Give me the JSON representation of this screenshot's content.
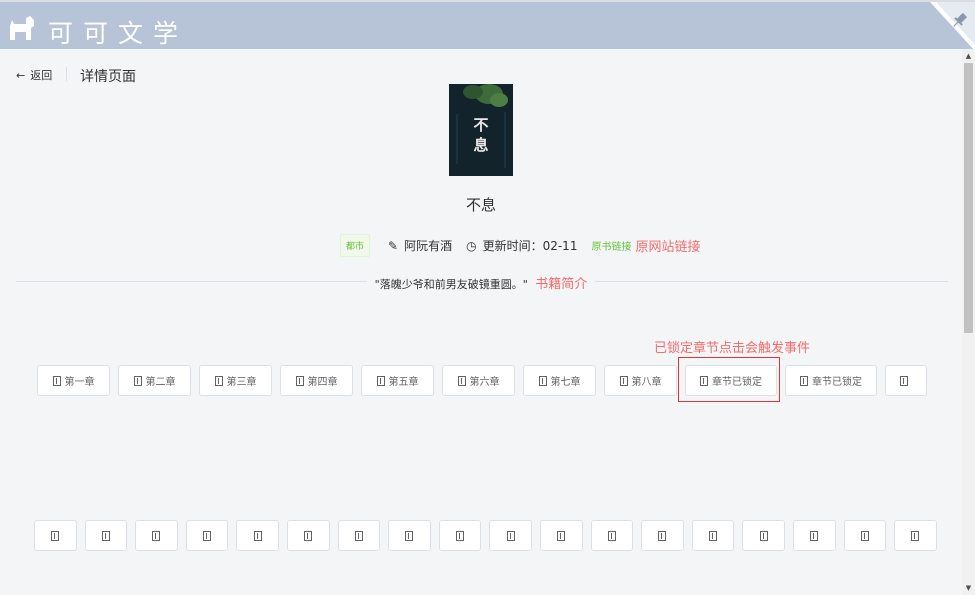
{
  "header": {
    "site_title": "可可文学",
    "logo_icon": "dog-icon",
    "corner_icon": "pin-icon",
    "background": "#b7c3d6"
  },
  "nav": {
    "back_label": "返回",
    "page_title": "详情页面"
  },
  "book": {
    "cover_chars": [
      "不",
      "息"
    ],
    "title": "不息",
    "category_tag": "都市",
    "author": "阿阮有酒",
    "update_label": "更新时间：02-11",
    "original_link_label": "原书链接",
    "original_link_annotation": "原网站链接",
    "intro": "\"落魄少爷和前男友破镜重圆。\"",
    "intro_annotation": "书籍简介"
  },
  "locked_annotation": "已锁定章节点击会触发事件",
  "chapters_row1": [
    {
      "label": "第一章"
    },
    {
      "label": "第二章"
    },
    {
      "label": "第三章"
    },
    {
      "label": "第四章"
    },
    {
      "label": "第五章"
    },
    {
      "label": "第六章"
    },
    {
      "label": "第七章"
    },
    {
      "label": "第八章"
    },
    {
      "label": "章节已锁定"
    },
    {
      "label": "章节已锁定"
    },
    {
      "label": ""
    }
  ],
  "chapters_row2_count": 18,
  "colors": {
    "accent_green": "#67c23a",
    "annotation_red": "#f56c6c",
    "highlight_red": "#e03535"
  }
}
